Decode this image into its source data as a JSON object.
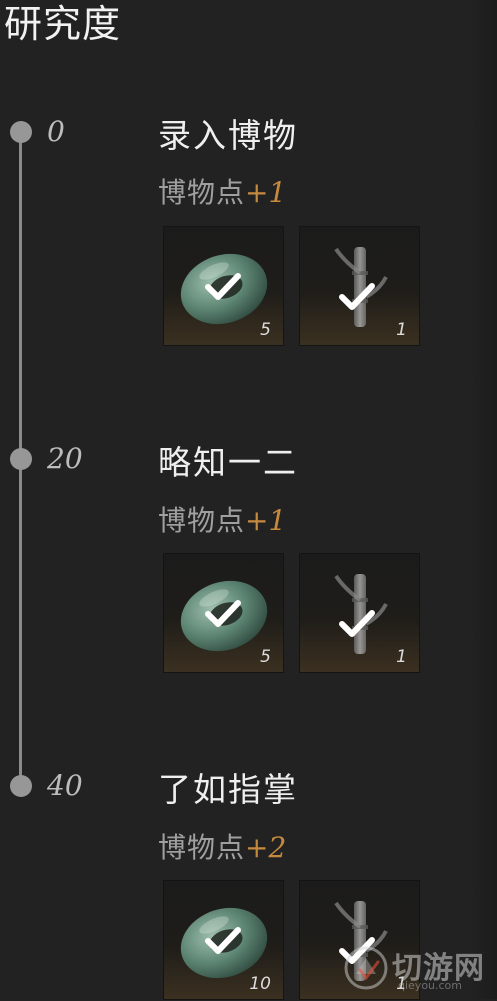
{
  "page": {
    "title": "研究度"
  },
  "stages": [
    {
      "threshold": "0",
      "name": "录入博物",
      "reward_label": "博物点",
      "reward_value": "+1",
      "items": [
        {
          "icon": "jade-ring-icon",
          "count": "5",
          "claimed": true
        },
        {
          "icon": "bamboo-icon",
          "count": "1",
          "claimed": true
        }
      ]
    },
    {
      "threshold": "20",
      "name": "略知一二",
      "reward_label": "博物点",
      "reward_value": "+1",
      "items": [
        {
          "icon": "jade-ring-icon",
          "count": "5",
          "claimed": true
        },
        {
          "icon": "bamboo-icon",
          "count": "1",
          "claimed": true
        }
      ]
    },
    {
      "threshold": "40",
      "name": "了如指掌",
      "reward_label": "博物点",
      "reward_value": "+2",
      "items": [
        {
          "icon": "jade-ring-icon",
          "count": "10",
          "claimed": true
        },
        {
          "icon": "bamboo-icon",
          "count": "1",
          "claimed": true
        }
      ]
    }
  ],
  "watermark": {
    "text": "切游网",
    "sub": "qieyou.com"
  }
}
